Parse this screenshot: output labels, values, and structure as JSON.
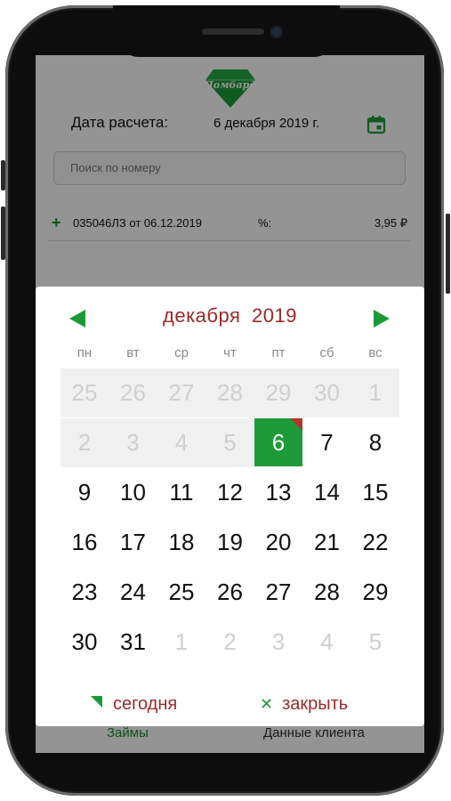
{
  "header": {
    "logo_text": "Ломбард",
    "date_label": "Дата расчета:",
    "date_value": "6 декабря 2019 г."
  },
  "search": {
    "placeholder": "Поиск по номеру"
  },
  "loan": {
    "id_text": "035046ЛЗ от 06.12.2019",
    "pct_label": "%:",
    "amount": "3,95 ₽"
  },
  "tabs": {
    "left": "Займы",
    "right": "Данные клиента"
  },
  "picker": {
    "month": "декабря",
    "year": "2019",
    "weekdays": [
      "пн",
      "вт",
      "ср",
      "чт",
      "пт",
      "сб",
      "вс"
    ],
    "weeks": [
      [
        "25",
        "26",
        "27",
        "28",
        "29",
        "30",
        "1"
      ],
      [
        "2",
        "3",
        "4",
        "5",
        "6",
        "7",
        "8"
      ],
      [
        "9",
        "10",
        "11",
        "12",
        "13",
        "14",
        "15"
      ],
      [
        "16",
        "17",
        "18",
        "19",
        "20",
        "21",
        "22"
      ],
      [
        "23",
        "24",
        "25",
        "26",
        "27",
        "28",
        "29"
      ],
      [
        "30",
        "31",
        "1",
        "2",
        "3",
        "4",
        "5"
      ]
    ],
    "selected_day": "6",
    "today_label": "сегодня",
    "close_label": "закрыть"
  },
  "colors": {
    "accent_green": "#1d9b3a",
    "accent_red": "#9a2a2a",
    "muted": "#cfcfcf"
  }
}
